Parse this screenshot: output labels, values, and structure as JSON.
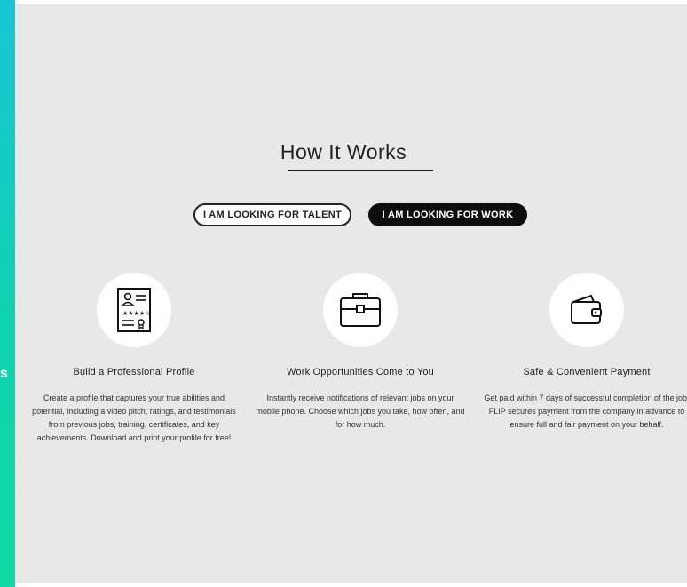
{
  "sidebar": {
    "partial_text": "s"
  },
  "section": {
    "title": "How It Works"
  },
  "toggles": {
    "talent_label": "I AM LOOKING FOR TALENT",
    "work_label": "I AM LOOKING FOR WORK",
    "active": "work"
  },
  "features": [
    {
      "icon": "profile-card-icon",
      "title": "Build a Professional Profile",
      "description": "Create a profile that captures your true abilities and potential, including a video pitch, ratings, and testimonials from previous jobs, training, certificates, and key achievements. Download and print your profile for free!"
    },
    {
      "icon": "briefcase-icon",
      "title": "Work Opportunities Come to You",
      "description": "Instantly receive notifications of relevant jobs on your mobile phone. Choose which jobs you take, how often, and for how much."
    },
    {
      "icon": "wallet-icon",
      "title": "Safe & Convenient Payment",
      "description": "Get paid within 7 days of successful completion of the job. FLIP secures payment from the company in advance to ensure full and fair payment on your behalf."
    }
  ]
}
